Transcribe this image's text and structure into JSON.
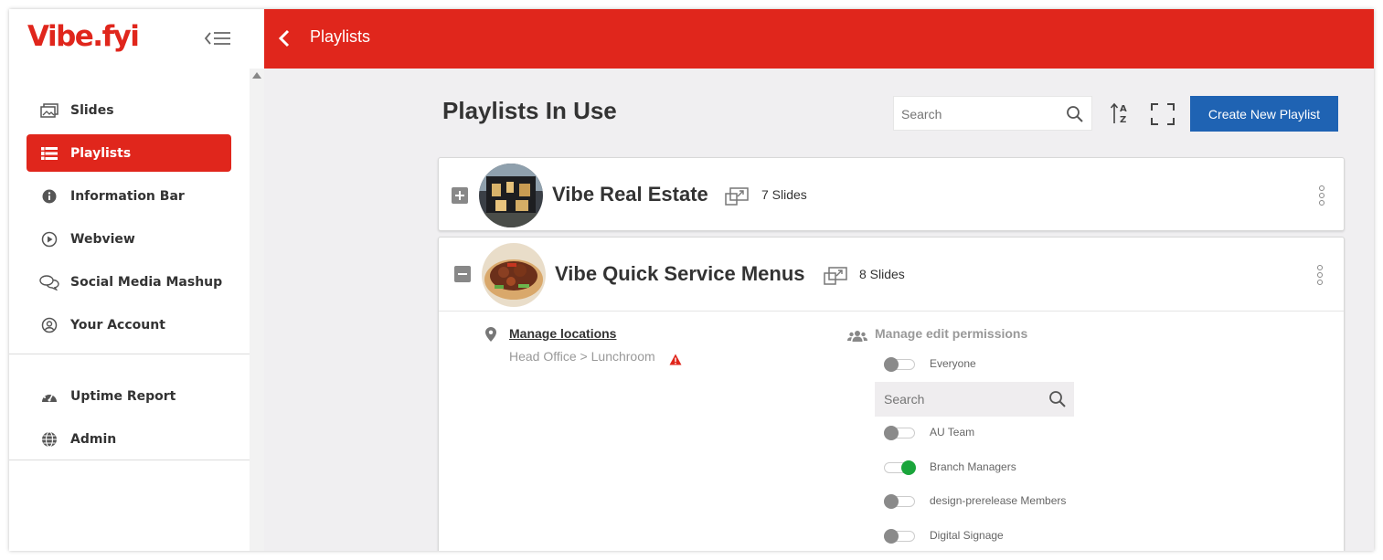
{
  "app": {
    "logo": "Vibe.fyi",
    "accent_color": "#e0261c",
    "button_color": "#1f63b3"
  },
  "sidebar": {
    "collapse_icon": "collapse-menu-icon",
    "items": [
      {
        "label": "Slides",
        "icon": "images-icon"
      },
      {
        "label": "Playlists",
        "icon": "list-icon",
        "active": true
      },
      {
        "label": "Information Bar",
        "icon": "info-icon"
      },
      {
        "label": "Webview",
        "icon": "play-icon"
      },
      {
        "label": "Social Media Mashup",
        "icon": "chat-bubbles-icon"
      },
      {
        "label": "Your Account",
        "icon": "user-circle-icon"
      }
    ],
    "secondary_items": [
      {
        "label": "Uptime Report",
        "icon": "gauge-icon"
      },
      {
        "label": "Admin",
        "icon": "globe-icon"
      }
    ]
  },
  "header": {
    "title": "Playlists",
    "back_icon": "chevron-left-icon"
  },
  "main": {
    "title": "Playlists In Use",
    "search_placeholder": "Search",
    "create_button": "Create New Playlist",
    "playlists": [
      {
        "name": "Vibe Real Estate",
        "slides": "7 Slides",
        "expanded": false
      },
      {
        "name": "Vibe Quick Service Menus",
        "slides": "8 Slides",
        "expanded": true,
        "manage_locations": "Manage locations",
        "location_path": "Head Office > Lunchroom",
        "manage_permissions": "Manage edit permissions",
        "permission_search_placeholder": "Search",
        "permissions": [
          {
            "name": "Everyone",
            "enabled": false
          },
          {
            "name": "AU Team",
            "enabled": false
          },
          {
            "name": "Branch Managers",
            "enabled": true
          },
          {
            "name": "design-prerelease Members",
            "enabled": false
          },
          {
            "name": "Digital Signage",
            "enabled": false
          }
        ]
      }
    ]
  }
}
